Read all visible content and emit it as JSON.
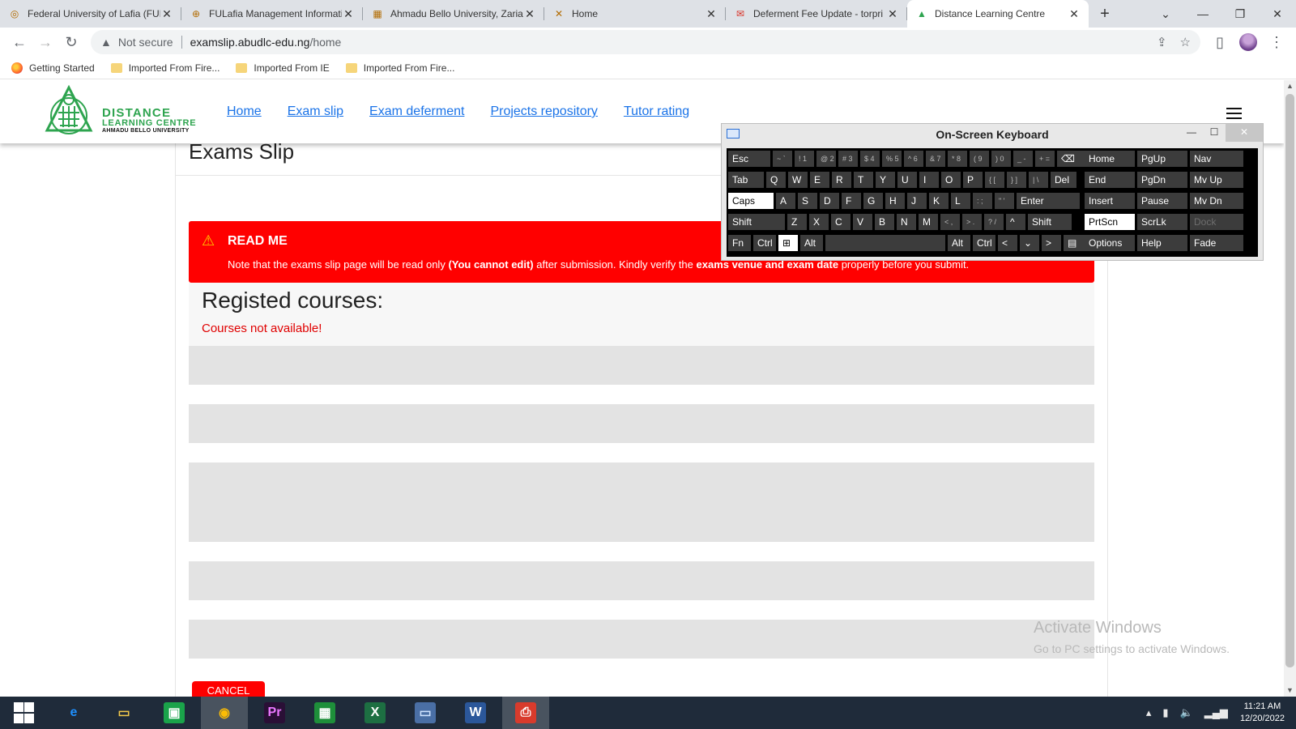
{
  "browser": {
    "tabs": [
      {
        "title": "Federal University of Lafia (FUL",
        "icon": "ful-logo-icon",
        "active": false
      },
      {
        "title": "FULafia Management Informati",
        "icon": "globe-icon",
        "active": false
      },
      {
        "title": "Ahmadu Bello University, Zaria",
        "icon": "abu-logo-icon",
        "active": false
      },
      {
        "title": "Home",
        "icon": "home-logo-icon",
        "active": false
      },
      {
        "title": "Deferment Fee Update - torpri",
        "icon": "gmail-icon",
        "active": false
      },
      {
        "title": "Distance Learning Centre",
        "icon": "dlc-logo-icon",
        "active": true
      }
    ],
    "address": {
      "security_label": "Not secure",
      "host": "examslip.abudlc-edu.ng",
      "path": "/home"
    },
    "bookmarks": [
      {
        "label": "Getting Started",
        "icon": "firefox-icon"
      },
      {
        "label": "Imported From Fire...",
        "icon": "folder-icon"
      },
      {
        "label": "Imported From IE",
        "icon": "folder-icon"
      },
      {
        "label": "Imported From Fire...",
        "icon": "folder-icon"
      }
    ]
  },
  "site": {
    "logo": {
      "line1": "DISTANCE",
      "line2": "LEARNING CENTRE",
      "line3": "AHMADU BELLO UNIVERSITY"
    },
    "nav": [
      "Home",
      "Exam slip",
      "Exam deferment",
      "Projects repository",
      "Tutor rating"
    ],
    "page_title": "Exams Slip",
    "alert": {
      "heading": "READ ME",
      "message_parts": [
        "Note that the exams slip page will be read only ",
        "(You cannot edit)",
        " after submission. Kindly verify the ",
        "exams venue and exam date",
        " properly before you submit."
      ]
    },
    "courses_heading": "Registed courses:",
    "courses_empty": "Courses not available!",
    "cancel_label": "CANCEL",
    "colors": {
      "accent_green": "#2ea44f",
      "alert_red": "#ff0000",
      "link_blue": "#1a73e8"
    }
  },
  "watermark": {
    "line1": "Activate Windows",
    "line2": "Go to PC settings to activate Windows."
  },
  "osk": {
    "title": "On-Screen Keyboard",
    "rows": [
      [
        {
          "l": "Esc"
        },
        {
          "l": "~ `",
          "s": 1
        },
        {
          "l": "! 1",
          "s": 1
        },
        {
          "l": "@ 2",
          "s": 1
        },
        {
          "l": "# 3",
          "s": 1
        },
        {
          "l": "$ 4",
          "s": 1
        },
        {
          "l": "% 5",
          "s": 1
        },
        {
          "l": "^ 6",
          "s": 1
        },
        {
          "l": "& 7",
          "s": 1
        },
        {
          "l": "* 8",
          "s": 1
        },
        {
          "l": "( 9",
          "s": 1
        },
        {
          "l": ") 0",
          "s": 1
        },
        {
          "l": "_ -",
          "s": 1
        },
        {
          "l": "+ =",
          "s": 1
        },
        {
          "l": "⌫"
        },
        {
          "l": "Home"
        },
        {
          "l": "PgUp"
        },
        {
          "l": "Nav"
        }
      ],
      [
        {
          "l": "Tab"
        },
        {
          "l": "Q"
        },
        {
          "l": "W"
        },
        {
          "l": "E"
        },
        {
          "l": "R"
        },
        {
          "l": "T"
        },
        {
          "l": "Y"
        },
        {
          "l": "U"
        },
        {
          "l": "I"
        },
        {
          "l": "O"
        },
        {
          "l": "P"
        },
        {
          "l": "{ [",
          "s": 1
        },
        {
          "l": "} ]",
          "s": 1
        },
        {
          "l": "| \\",
          "s": 1
        },
        {
          "l": "Del"
        },
        {
          "l": "End"
        },
        {
          "l": "PgDn"
        },
        {
          "l": "Mv Up"
        }
      ],
      [
        {
          "l": "Caps",
          "a": 1
        },
        {
          "l": "A"
        },
        {
          "l": "S"
        },
        {
          "l": "D"
        },
        {
          "l": "F"
        },
        {
          "l": "G"
        },
        {
          "l": "H"
        },
        {
          "l": "J"
        },
        {
          "l": "K"
        },
        {
          "l": "L"
        },
        {
          "l": ": ;",
          "s": 1
        },
        {
          "l": "\" '",
          "s": 1
        },
        {
          "l": "Enter"
        },
        {
          "l": "Insert"
        },
        {
          "l": "Pause"
        },
        {
          "l": "Mv Dn"
        }
      ],
      [
        {
          "l": "Shift"
        },
        {
          "l": "Z"
        },
        {
          "l": "X"
        },
        {
          "l": "C"
        },
        {
          "l": "V"
        },
        {
          "l": "B"
        },
        {
          "l": "N"
        },
        {
          "l": "M"
        },
        {
          "l": "< ,",
          "s": 1
        },
        {
          "l": "> .",
          "s": 1
        },
        {
          "l": "? /",
          "s": 1
        },
        {
          "l": "^"
        },
        {
          "l": "Shift"
        },
        {
          "l": "PrtScn",
          "a": 1
        },
        {
          "l": "ScrLk"
        },
        {
          "l": "Dock",
          "d": 1
        }
      ],
      [
        {
          "l": "Fn"
        },
        {
          "l": "Ctrl"
        },
        {
          "l": "⊞",
          "a": 1
        },
        {
          "l": "Alt"
        },
        {
          "l": ""
        },
        {
          "l": "Alt"
        },
        {
          "l": "Ctrl"
        },
        {
          "l": "<"
        },
        {
          "l": "⌄"
        },
        {
          "l": ">"
        },
        {
          "l": "▤"
        },
        {
          "l": "Options"
        },
        {
          "l": "Help"
        },
        {
          "l": "Fade"
        }
      ]
    ]
  },
  "taskbar": {
    "apps": [
      "start-icon",
      "ie-icon",
      "explorer-icon",
      "store-icon",
      "chrome-icon",
      "premiere-icon",
      "calculator-icon",
      "excel-icon",
      "remote-desktop-icon",
      "word-icon",
      "acrobat-icon"
    ],
    "time": "11:21 AM",
    "date": "12/20/2022"
  }
}
